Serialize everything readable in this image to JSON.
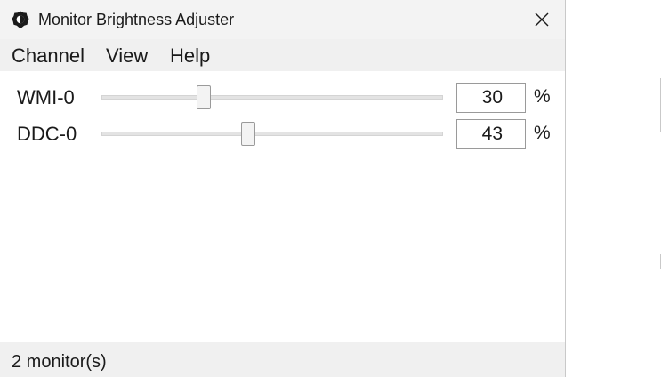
{
  "window": {
    "title": "Monitor Brightness Adjuster",
    "app_icon": "brightness-gear-icon",
    "close_icon": "close-icon"
  },
  "menu": {
    "items": [
      {
        "label": "Channel"
      },
      {
        "label": "View"
      },
      {
        "label": "Help"
      }
    ]
  },
  "channels": [
    {
      "label": "WMI-0",
      "value": "30",
      "unit": "%",
      "level_percent": 30
    },
    {
      "label": "DDC-0",
      "value": "43",
      "unit": "%",
      "level_percent": 43
    }
  ],
  "status": {
    "text": "2 monitor(s)"
  },
  "colors": {
    "titlebar_bg": "#f3f3f3",
    "menubar_bg": "#f0f0f0",
    "statusbar_bg": "#f0f0f0",
    "window_bg": "#ffffff"
  }
}
